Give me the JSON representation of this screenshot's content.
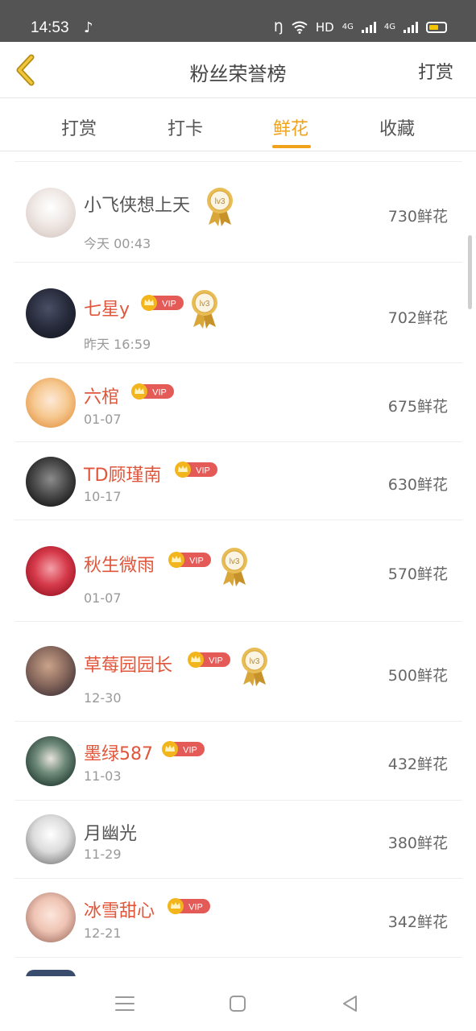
{
  "status_bar": {
    "time": "14:53",
    "network_label": "HD",
    "signal_1": "4G",
    "signal_2": "4G",
    "battery_color": "#f2c500"
  },
  "header": {
    "title": "粉丝荣誉榜",
    "action_label": "打赏",
    "back_icon": "chevron-left-icon",
    "accent_color": "#f0a21b"
  },
  "tabs": [
    {
      "label": "打赏",
      "active": false
    },
    {
      "label": "打卡",
      "active": false
    },
    {
      "label": "鲜花",
      "active": true
    },
    {
      "label": "收藏",
      "active": false
    }
  ],
  "fans": [
    {
      "name": "小飞侠想上天",
      "time": "今天 00:43",
      "amount": "730鲜花",
      "vip": false,
      "medal": "lv3"
    },
    {
      "name": "七星y",
      "time": "昨天 16:59",
      "amount": "702鲜花",
      "vip": true,
      "medal": "lv3"
    },
    {
      "name": "六棺",
      "time": "01-07",
      "amount": "675鲜花",
      "vip": true,
      "medal": ""
    },
    {
      "name": "TD顾瑾南",
      "time": "10-17",
      "amount": "630鲜花",
      "vip": true,
      "medal": ""
    },
    {
      "name": "秋生微雨",
      "time": "01-07",
      "amount": "570鲜花",
      "vip": true,
      "medal": "lv3"
    },
    {
      "name": "草莓园园长",
      "time": "12-30",
      "amount": "500鲜花",
      "vip": true,
      "medal": "lv3"
    },
    {
      "name": "墨绿587",
      "time": "11-03",
      "amount": "432鲜花",
      "vip": true,
      "medal": ""
    },
    {
      "name": "月幽光",
      "time": "11-29",
      "amount": "380鲜花",
      "vip": false,
      "medal": ""
    },
    {
      "name": "冰雪甜心",
      "time": "12-21",
      "amount": "342鲜花",
      "vip": true,
      "medal": ""
    }
  ],
  "badges": {
    "vip_label": "VIP",
    "medal_label": "lv3",
    "vip_color": "#e35a57",
    "crown_color": "#f3b51c",
    "medal_color": "#d9a63a"
  },
  "nav_bar": {
    "menu_icon": "menu-icon",
    "home_icon": "square-home-icon",
    "back_icon": "triangle-back-icon"
  }
}
